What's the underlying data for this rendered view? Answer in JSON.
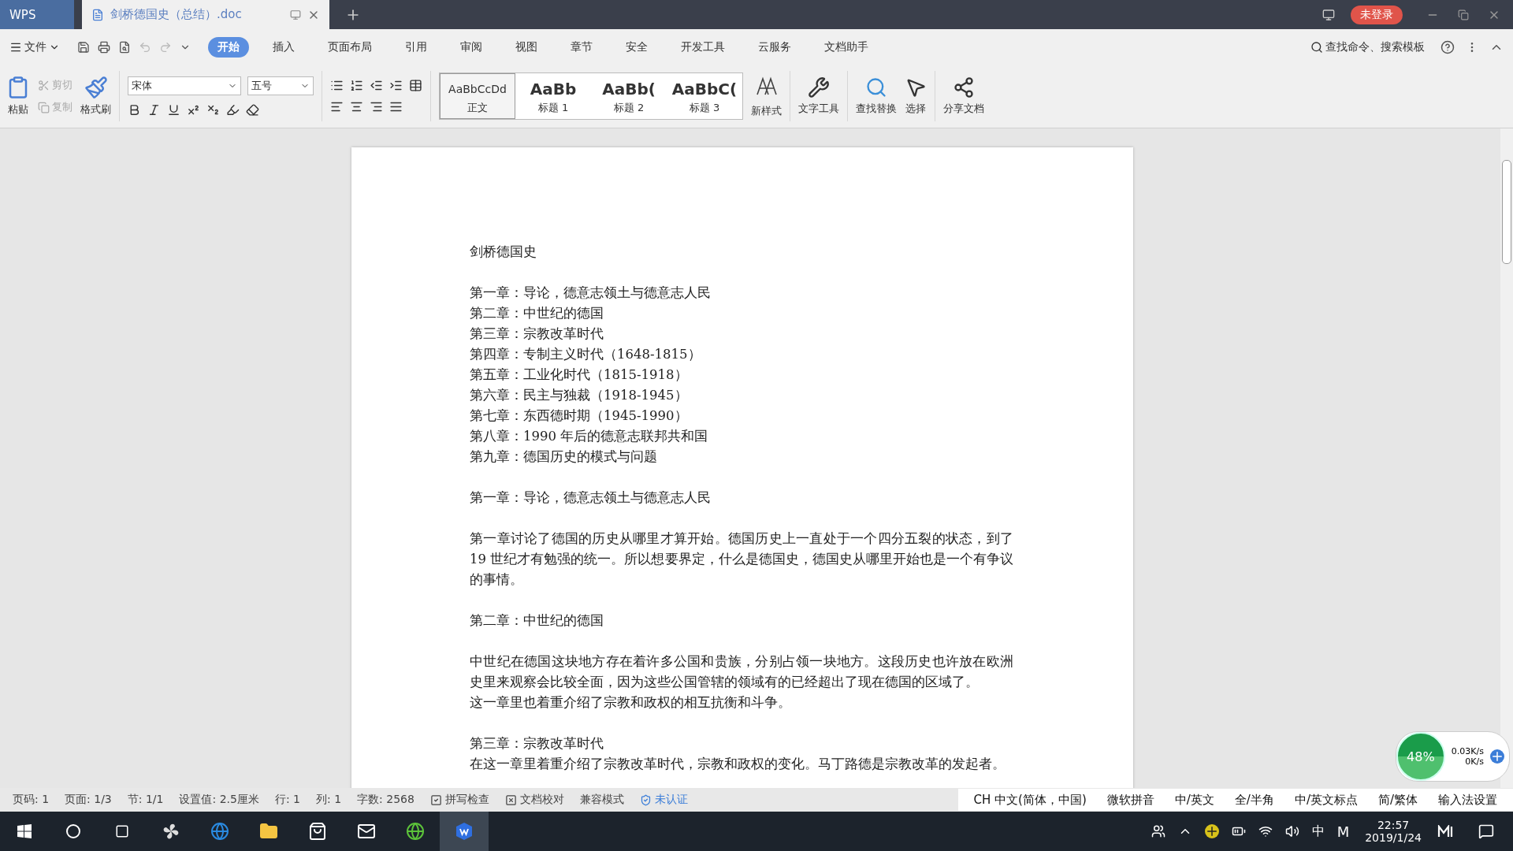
{
  "title_bar": {
    "tabs": [
      {
        "kind": "home",
        "label": "WPS",
        "selected": false
      },
      {
        "kind": "doc",
        "label": "剑桥德国史（总结）.doc",
        "selected": true
      }
    ],
    "login": "未登录"
  },
  "menu": {
    "file": "文件",
    "tabs": [
      {
        "label": "开始",
        "selected": true
      },
      {
        "label": "插入",
        "selected": false
      },
      {
        "label": "页面布局",
        "selected": false
      },
      {
        "label": "引用",
        "selected": false
      },
      {
        "label": "审阅",
        "selected": false
      },
      {
        "label": "视图",
        "selected": false
      },
      {
        "label": "章节",
        "selected": false
      },
      {
        "label": "安全",
        "selected": false
      },
      {
        "label": "开发工具",
        "selected": false
      },
      {
        "label": "云服务",
        "selected": false
      },
      {
        "label": "文档助手",
        "selected": false
      }
    ],
    "search": "查找命令、搜索模板"
  },
  "toolbar": {
    "paste": "粘贴",
    "cut": {
      "label": "剪切",
      "disabled": true
    },
    "copy": {
      "label": "复制",
      "disabled": true
    },
    "format_painter": "格式刷",
    "font": "宋体",
    "size": "五号",
    "styles": [
      {
        "preview": "AaBbCcDd",
        "label": "正文",
        "selected": true
      },
      {
        "preview": "AaBb",
        "label": "标题 1",
        "selected": false
      },
      {
        "preview": "AaBb(",
        "label": "标题 2",
        "selected": false
      },
      {
        "preview": "AaBbC(",
        "label": "标题 3",
        "selected": false
      }
    ],
    "new_style": "新样式",
    "text_tools": "文字工具",
    "find_replace": "查找替换",
    "select": "选择",
    "share": "分享文档"
  },
  "document": {
    "groups": [
      [
        "剑桥德国史"
      ],
      [
        "第一章：导论，德意志领土与德意志人民",
        "第二章：中世纪的德国",
        "第三章：宗教改革时代",
        "第四章：专制主义时代（1648-1815）",
        "第五章：工业化时代（1815-1918）",
        "第六章：民主与独裁（1918-1945）",
        "第七章：东西德时期（1945-1990）",
        "第八章：1990 年后的德意志联邦共和国",
        "第九章：德国历史的模式与问题"
      ],
      [
        "第一章：导论，德意志领土与德意志人民"
      ],
      [
        "第一章讨论了德国的历史从哪里才算开始。德国历史上一直处于一个四分五裂的状态，到了 19 世纪才有勉强的统一。所以想要界定，什么是德国史，德国史从哪里开始也是一个有争议的事情。"
      ],
      [
        "第二章：中世纪的德国"
      ],
      [
        "中世纪在德国这块地方存在着许多公国和贵族，分别占领一块地方。这段历史也许放在欧洲史里来观察会比较全面，因为这些公国管辖的领域有的已经超出了现在德国的区域了。",
        "这一章里也着重介绍了宗教和政权的相互抗衡和斗争。"
      ],
      [
        "第三章：宗教改革时代",
        "在这一章里着重介绍了宗教改革时代，宗教和政权的变化。马丁路德是宗教改革的发起者。"
      ]
    ]
  },
  "status_bar": [
    {
      "kind": "text",
      "label": "页码: 1"
    },
    {
      "kind": "text",
      "label": "页面: 1/3"
    },
    {
      "kind": "text",
      "label": "节: 1/1"
    },
    {
      "kind": "text",
      "label": "设置值: 2.5厘米"
    },
    {
      "kind": "text",
      "label": "行: 1"
    },
    {
      "kind": "text",
      "label": "列: 1"
    },
    {
      "kind": "text",
      "label": "字数: 2568"
    },
    {
      "kind": "spell",
      "label": "拼写检查"
    },
    {
      "kind": "proof",
      "label": "文档校对"
    },
    {
      "kind": "text",
      "label": "兼容模式"
    },
    {
      "kind": "cert",
      "label": "未认证"
    }
  ],
  "net_widget": {
    "percent": "48%",
    "up": "0.03K/s",
    "down": "0K/s"
  },
  "ime_bar": [
    "CH 中文(简体，中国)",
    "微软拼音",
    "中/英文",
    "全/半角",
    "中/英文标点",
    "简/繁体",
    "输入法设置"
  ],
  "taskbar": {
    "ime": "中",
    "ime_mode": "M",
    "time": "22:57",
    "date": "2019/1/24"
  }
}
